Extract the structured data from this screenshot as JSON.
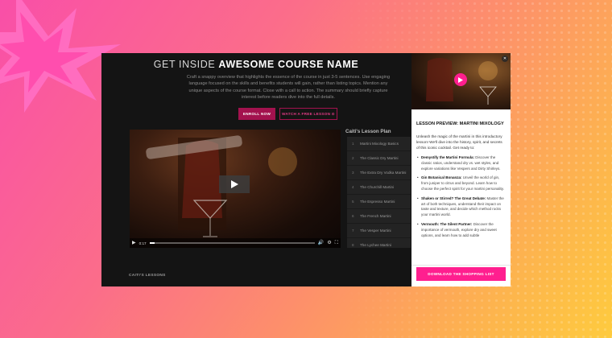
{
  "colors": {
    "accent": "#ff1f8f",
    "enroll_button": "#a3124e",
    "panel_bg": "#ffffff",
    "frame_bg": "#141414"
  },
  "hero": {
    "headline_prefix": "GET INSIDE ",
    "headline_strong": "AWESOME COURSE NAME",
    "description": "Craft a snappy overview that highlights the essence of the course in just 3-5 sentences. Use engaging language focused on the skills and benefits students will gain, rather than listing topics. Mention any unique aspects of the course format. Close with a call to action. The summary should briefly capture interest before readers dive into the full details.",
    "enroll_label": "ENROLL NOW",
    "watch_label": "WATCH A FREE LESSON ⊙"
  },
  "video": {
    "time": "0:17",
    "progress": 0.03,
    "icons": [
      "play-icon",
      "volume-icon",
      "settings-icon",
      "fullscreen-icon"
    ]
  },
  "lesson_plan": {
    "title": "Caiti's Lesson Plan",
    "items": [
      {
        "num": "1",
        "label": "Martini Mixology Basics"
      },
      {
        "num": "2",
        "label": "The Classic Dry Martini"
      },
      {
        "num": "3",
        "label": "The Extra Dry Vodka Martini"
      },
      {
        "num": "4",
        "label": "The Churchill Martini"
      },
      {
        "num": "5",
        "label": "The Espresso Martini"
      },
      {
        "num": "6",
        "label": "The French Martini"
      },
      {
        "num": "7",
        "label": "The Vesper Martini"
      },
      {
        "num": "8",
        "label": "The Lychee Martini"
      }
    ]
  },
  "lessons_label": "CAITI'S LESSONS",
  "preview_panel": {
    "heading": "LESSON PREVIEW: MARTINI MIXOLOGY",
    "intro": "Unleash the magic of the martini in this introductory lesson! We'll dive into the history, spirit, and secrets of this iconic cocktail. Get ready to:",
    "bullets": [
      {
        "title": "Demystify the Martini Formula:",
        "text": " Discover the classic ratios, understand dry vs. wet styles, and explore variations like Vespers and Dirty Shirleys."
      },
      {
        "title": "Gin Botanical Bonanza:",
        "text": " Unveil the world of gin, from juniper to citrus and beyond. Learn how to choose the perfect spirit for your martini personality."
      },
      {
        "title": "Shaken or Stirred? The Great Debate:",
        "text": " Master the art of both techniques, understand their impact on taste and texture, and decide which method rocks your martini world."
      },
      {
        "title": "Vermouth: The Silent Partner:",
        "text": " Discover the importance of vermouth, explore dry and sweet options, and learn how to add subtle"
      }
    ],
    "download_label": "DOWNLOAD THE SHOPPING LIST",
    "close_icon": "✕"
  }
}
